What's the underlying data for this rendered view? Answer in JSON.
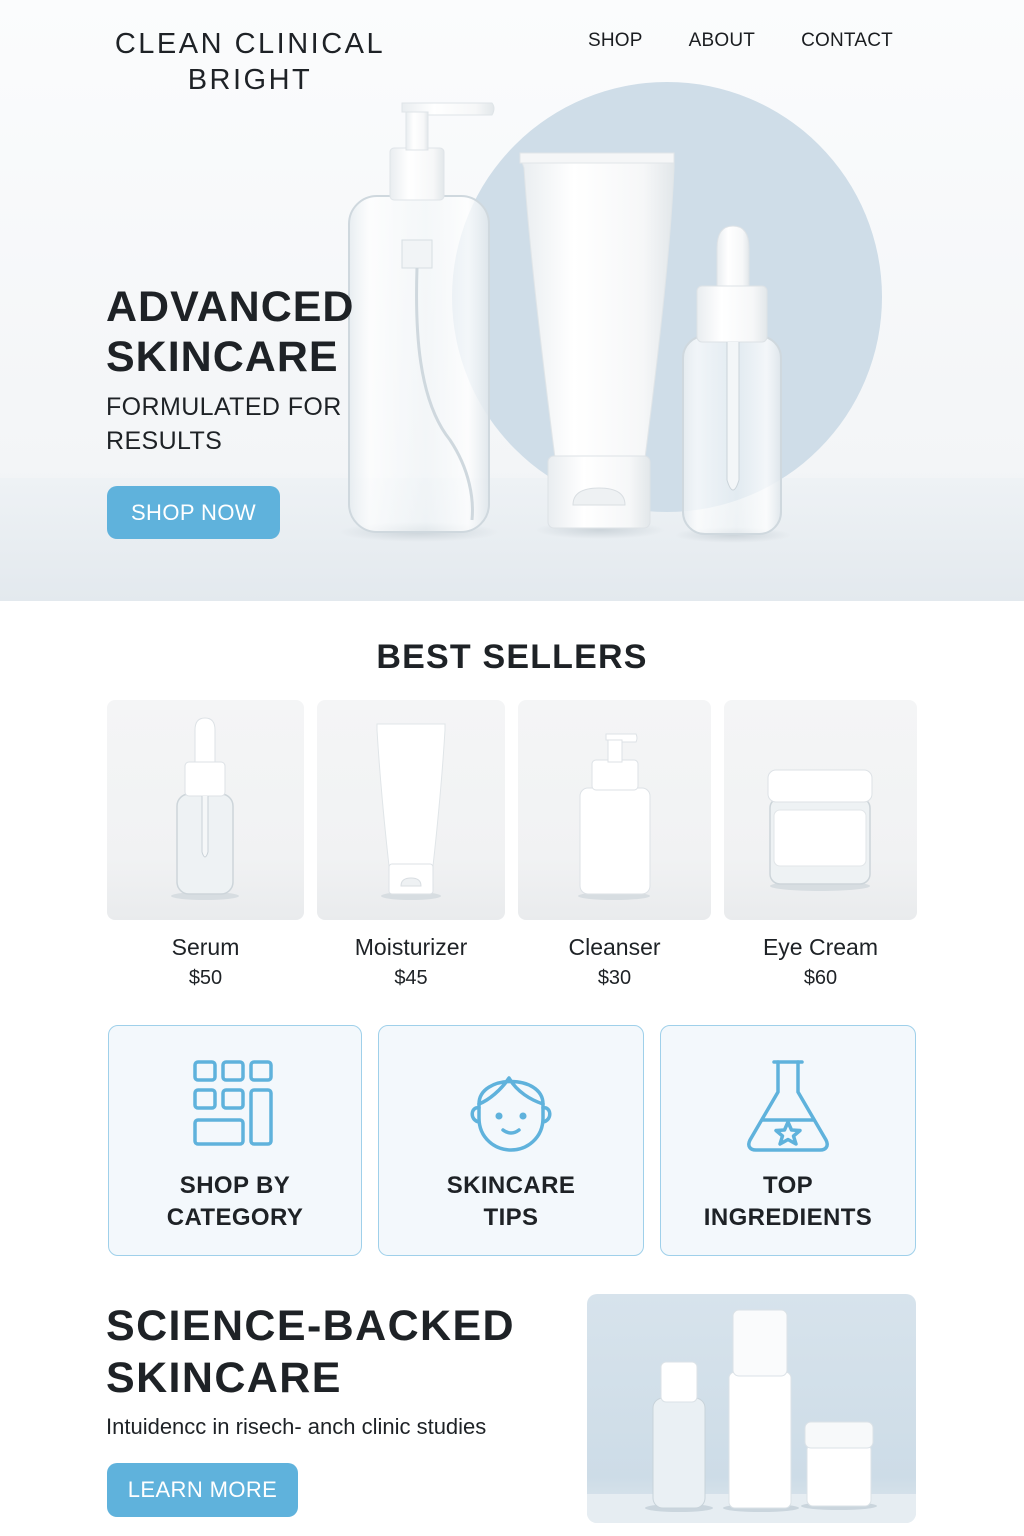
{
  "brand": {
    "line1": "CLEAN CLINICAL",
    "line2": "BRIGHT"
  },
  "nav": {
    "items": [
      "SHOP",
      "ABOUT",
      "CONTACT"
    ]
  },
  "hero": {
    "title_line1": "ADVANCED",
    "title_line2": "SKINCARE",
    "sub_line1": "FORMULATED FOR",
    "sub_line2": "RESULTS",
    "cta": "SHOP NOW"
  },
  "best_sellers": {
    "title": "BEST SELLERS",
    "products": [
      {
        "name": "Serum",
        "price": "$50",
        "icon": "dropper-bottle-icon"
      },
      {
        "name": "Moisturizer",
        "price": "$45",
        "icon": "tube-icon"
      },
      {
        "name": "Cleanser",
        "price": "$30",
        "icon": "pump-bottle-icon"
      },
      {
        "name": "Eye Cream",
        "price": "$60",
        "icon": "jar-icon"
      }
    ]
  },
  "cards": [
    {
      "line1": "SHOP BY",
      "line2": "CATEGORY",
      "icon": "grid-icon"
    },
    {
      "line1": "SKINCARE",
      "line2": "TIPS",
      "icon": "face-icon"
    },
    {
      "line1": "TOP",
      "line2": "INGREDIENTS",
      "icon": "flask-icon"
    }
  ],
  "science": {
    "title_line1": "SCIENCE-BACKED",
    "title_line2": "SKINCARE",
    "sub": "Intuidencc in risech- anch clinic studies",
    "cta": "LEARN MORE"
  },
  "colors": {
    "accent": "#5fb2dc",
    "card_border": "#9fd0ea",
    "card_bg": "#f3f8fc",
    "hero_circle": "#cfdde8",
    "text": "#1e2226"
  }
}
